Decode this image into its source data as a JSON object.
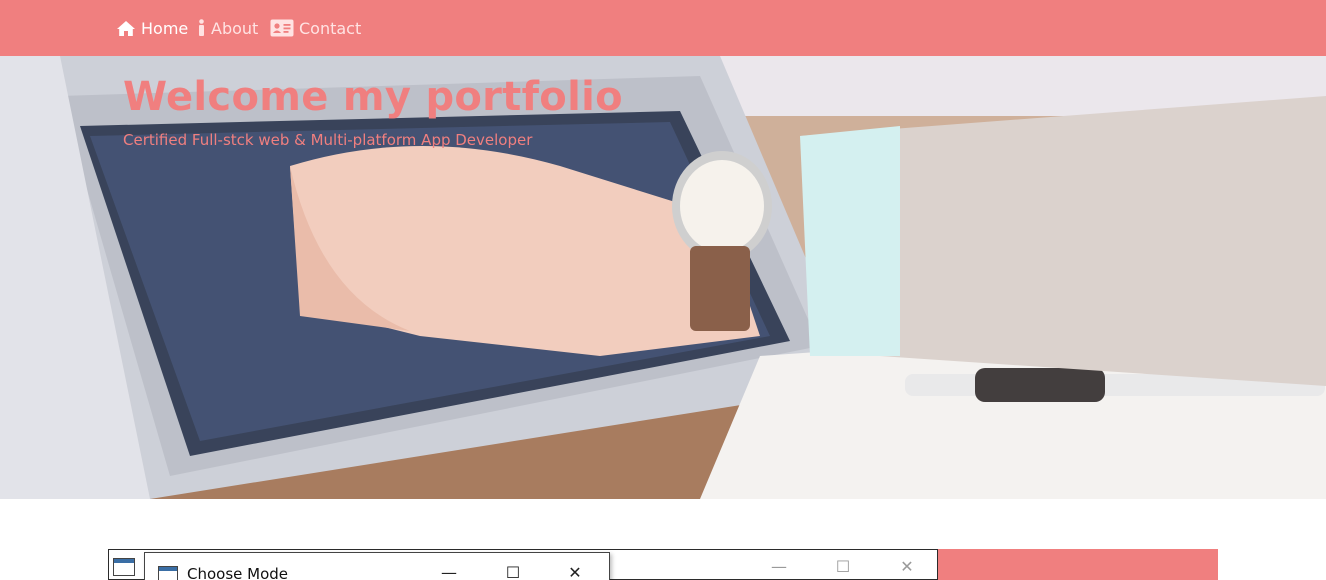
{
  "nav": {
    "items": [
      {
        "label": "Home",
        "icon": "home-icon",
        "active": true
      },
      {
        "label": "About",
        "icon": "info-icon",
        "active": false
      },
      {
        "label": "Contact",
        "icon": "address-card-icon",
        "active": false
      }
    ]
  },
  "hero": {
    "title": "Welcome my portfolio",
    "subtitle": "Certified Full-stck web & Multi-platform App Developer",
    "image": "laptop-typing-photo"
  },
  "screenshot": {
    "dialog_title": "Choose Mode",
    "minimize_glyph": "—",
    "maximize_glyph": "☐",
    "close_glyph": "✕"
  },
  "colors": {
    "accent": "#f07f7f",
    "nav_text_active": "#ffffff",
    "nav_text": "#ffe3e3"
  }
}
